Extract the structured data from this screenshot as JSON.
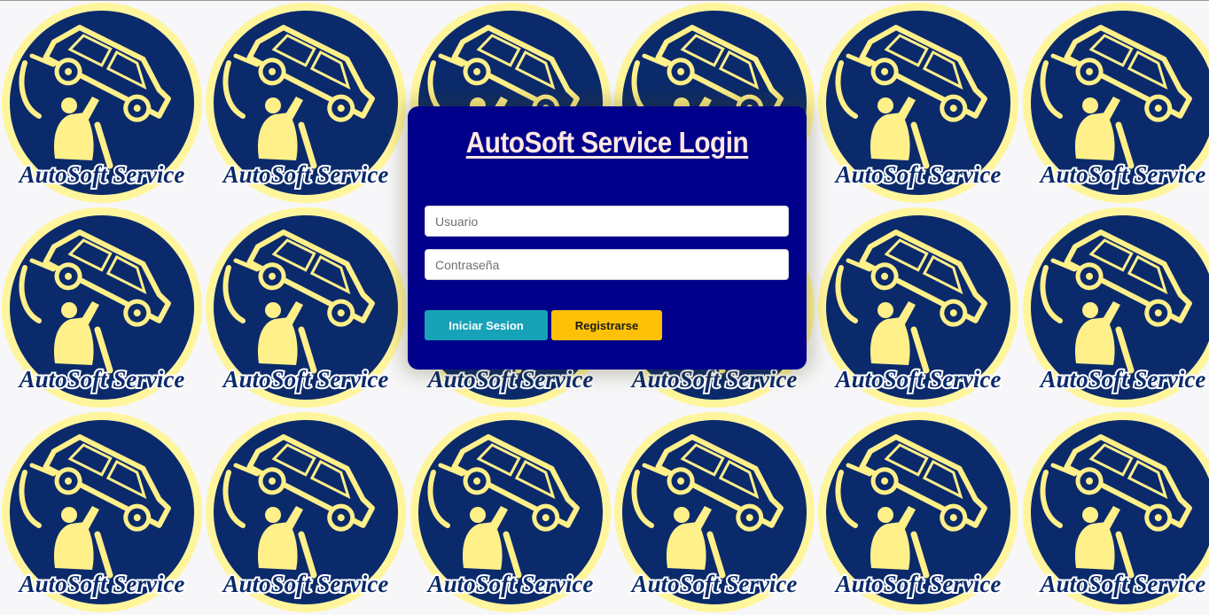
{
  "background": {
    "logo_text": "AutoSoft Service",
    "colors": {
      "circle_ring": "#fff59d",
      "circle_fill": "#0b2a6b",
      "artwork": "#fff08a"
    }
  },
  "login": {
    "title": "AutoSoft Service Login",
    "username_placeholder": "Usuario",
    "password_placeholder": "Contraseña",
    "login_label": "Iniciar Sesion",
    "register_label": "Registrarse",
    "colors": {
      "panel": "#00008b",
      "title": "#ffe8e0",
      "login_button": "#17a2b8",
      "register_button": "#ffc107"
    }
  }
}
